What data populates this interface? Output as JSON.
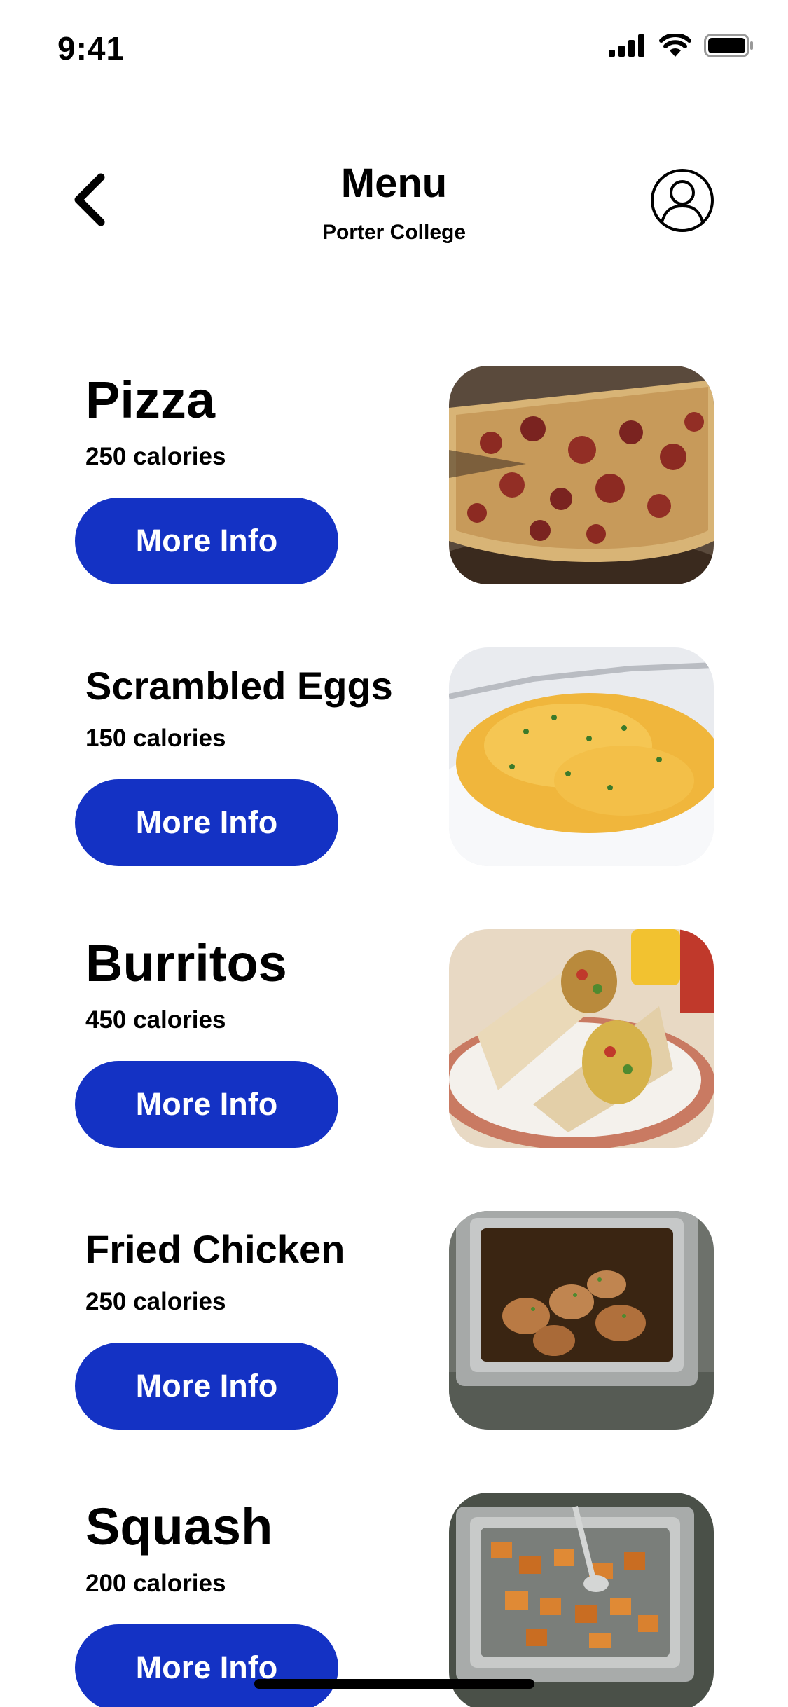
{
  "status_bar": {
    "time": "9:41"
  },
  "header": {
    "title": "Menu",
    "subtitle": "Porter College"
  },
  "menu": {
    "button_label": "More Info",
    "items": [
      {
        "name": "Pizza",
        "calories": "250 calories"
      },
      {
        "name": "Scrambled Eggs",
        "calories": "150 calories"
      },
      {
        "name": "Burritos",
        "calories": "450 calories"
      },
      {
        "name": "Fried Chicken",
        "calories": "250 calories"
      },
      {
        "name": "Squash",
        "calories": "200 calories"
      }
    ]
  },
  "colors": {
    "accent": "#1432c4",
    "background": "#ffffff",
    "text": "#000000"
  },
  "icons": {
    "back": "chevron-left-icon",
    "profile": "person-circle-icon"
  }
}
